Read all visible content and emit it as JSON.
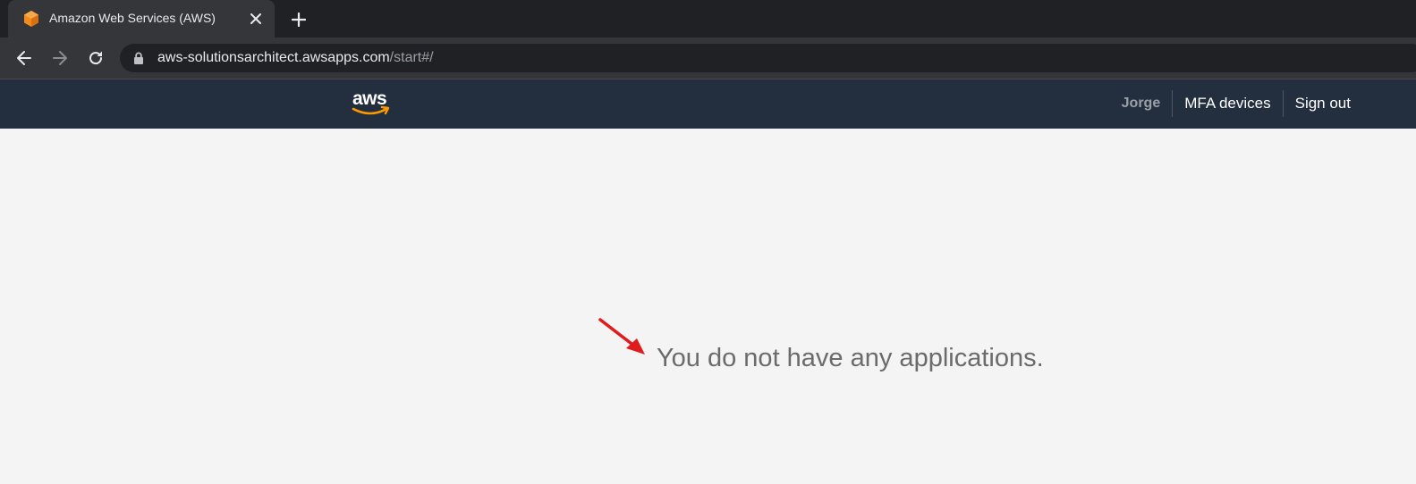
{
  "browser": {
    "tab_title": "Amazon Web Services (AWS)",
    "url_host": "aws-solutionsarchitect.awsapps.com",
    "url_path": "/start#/",
    "icons": {
      "favicon": "aws-cube-icon",
      "close": "close-icon",
      "new_tab": "plus-icon",
      "back": "back-arrow-icon",
      "forward": "forward-arrow-icon",
      "reload": "reload-icon",
      "lock": "lock-icon"
    }
  },
  "header": {
    "logo_text": "aws",
    "user_name": "Jorge",
    "mfa_label": "MFA devices",
    "signout_label": "Sign out"
  },
  "main": {
    "empty_message": "You do not have any applications."
  },
  "colors": {
    "chrome_dark": "#202124",
    "chrome_tab": "#35363a",
    "aws_header": "#232f3e",
    "aws_orange": "#ff9900",
    "page_bg": "#f4f4f4",
    "annotation_red": "#e01b1b"
  }
}
